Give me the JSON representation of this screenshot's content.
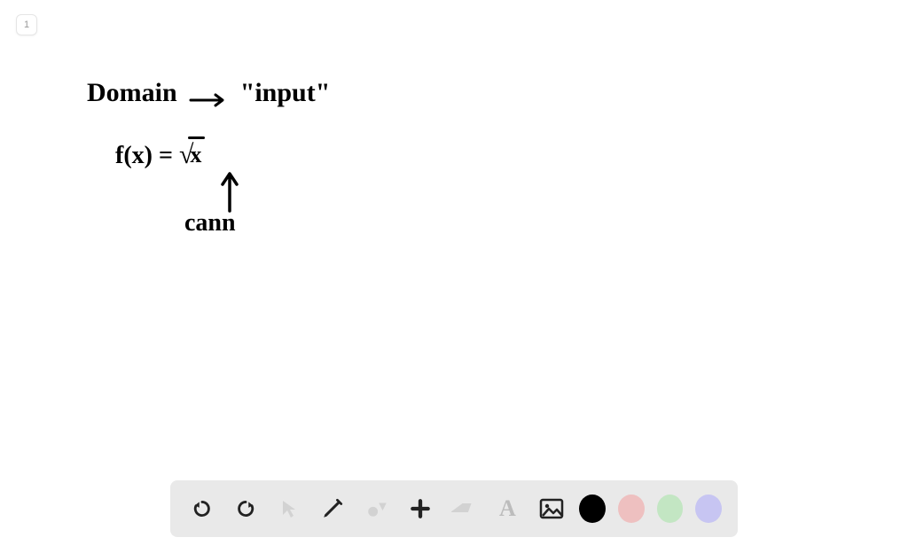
{
  "page": {
    "number": "1"
  },
  "notes": {
    "line1_a": "Domain",
    "line1_b": "\"input\"",
    "line2_a": "f(x) =",
    "line2_sqrt_arg": "x",
    "line3": "cann"
  },
  "toolbar": {
    "undo": "Undo",
    "redo": "Redo",
    "select": "Select",
    "pen": "Pen",
    "shapes": "Shapes",
    "add": "Add",
    "eraser": "Eraser",
    "text": "A",
    "image": "Image",
    "colors": {
      "black": "#000000",
      "red": "#eec0c0",
      "green": "#c3e6c3",
      "purple": "#c7c5f2"
    }
  }
}
